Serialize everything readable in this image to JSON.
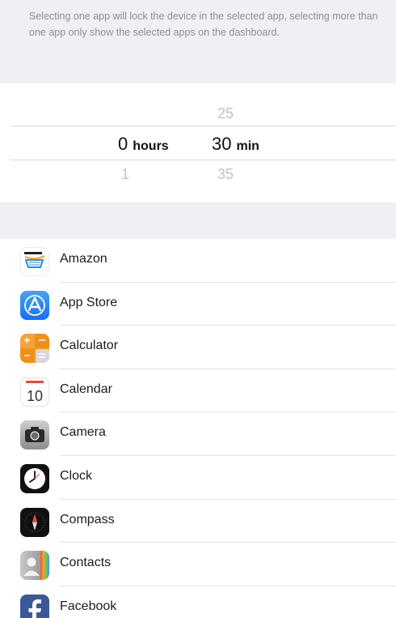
{
  "note": {
    "text": "Selecting one app will lock the device in the selected app, selecting more than one app only show the selected apps on the dashboard."
  },
  "picker": {
    "hours_above": "",
    "hours_selected": "0",
    "hours_unit": "hours",
    "hours_below": "1",
    "minutes_above": "25",
    "minutes_selected": "30",
    "minutes_unit": "min",
    "minutes_below": "35"
  },
  "apps": [
    {
      "label": "Amazon",
      "icon": "amazon-icon"
    },
    {
      "label": "App Store",
      "icon": "app-store-icon"
    },
    {
      "label": "Calculator",
      "icon": "calculator-icon"
    },
    {
      "label": "Calendar",
      "icon": "calendar-icon",
      "icon_day": "10"
    },
    {
      "label": "Camera",
      "icon": "camera-icon"
    },
    {
      "label": "Clock",
      "icon": "clock-icon"
    },
    {
      "label": "Compass",
      "icon": "compass-icon"
    },
    {
      "label": "Contacts",
      "icon": "contacts-icon"
    },
    {
      "label": "Facebook",
      "icon": "facebook-icon"
    }
  ],
  "colors": {
    "section_background": "#f0f0f4",
    "secondary_text": "#8e8e93",
    "separator": "#e3e3e8"
  }
}
